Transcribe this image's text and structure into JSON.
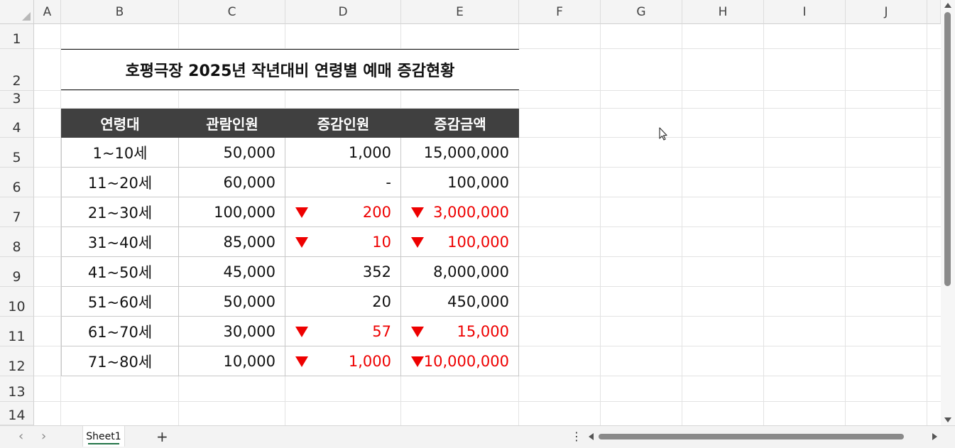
{
  "columns": [
    "A",
    "B",
    "C",
    "D",
    "E",
    "F",
    "G",
    "H",
    "I",
    "J"
  ],
  "rows": [
    "1",
    "2",
    "3",
    "4",
    "5",
    "6",
    "7",
    "8",
    "9",
    "10",
    "11",
    "12",
    "13",
    "14"
  ],
  "title": "호평극장 2025년 작년대비 연령별 예매 증감현황",
  "table": {
    "headers": [
      "연령대",
      "관람인원",
      "증감인원",
      "증감금액"
    ],
    "rows": [
      {
        "age": "1~10세",
        "audience": "50,000",
        "change_people": "1,000",
        "change_amount": "15,000,000",
        "people_down": false,
        "amount_down": false
      },
      {
        "age": "11~20세",
        "audience": "60,000",
        "change_people": "-",
        "change_amount": "100,000",
        "people_down": false,
        "amount_down": false
      },
      {
        "age": "21~30세",
        "audience": "100,000",
        "change_people": "200",
        "change_amount": "3,000,000",
        "people_down": true,
        "amount_down": true
      },
      {
        "age": "31~40세",
        "audience": "85,000",
        "change_people": "10",
        "change_amount": "100,000",
        "people_down": true,
        "amount_down": true
      },
      {
        "age": "41~50세",
        "audience": "45,000",
        "change_people": "352",
        "change_amount": "8,000,000",
        "people_down": false,
        "amount_down": false
      },
      {
        "age": "51~60세",
        "audience": "50,000",
        "change_people": "20",
        "change_amount": "450,000",
        "people_down": false,
        "amount_down": false
      },
      {
        "age": "61~70세",
        "audience": "30,000",
        "change_people": "57",
        "change_amount": "15,000",
        "people_down": true,
        "amount_down": true
      },
      {
        "age": "71~80세",
        "audience": "10,000",
        "change_people": "1,000",
        "change_amount": "10,000,000",
        "people_down": true,
        "amount_down": true
      }
    ]
  },
  "sheet_tabs": [
    "Sheet1"
  ],
  "add_sheet": "+",
  "nav_prev": "‹",
  "nav_next": "›",
  "more_menu": "⋮",
  "colors": {
    "header_bg": "#404040",
    "decrease": "#ee0000",
    "active_tab": "#217346"
  }
}
